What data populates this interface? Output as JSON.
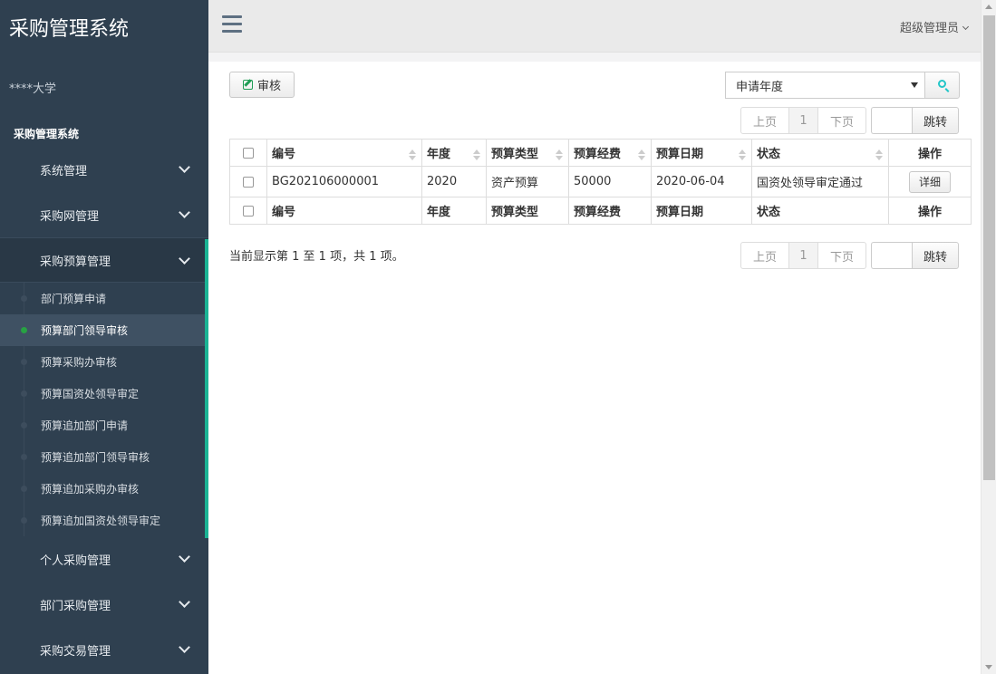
{
  "app": {
    "brand": "采购管理系统",
    "org": "****大学",
    "section_label": "采购管理系统"
  },
  "sidebar": {
    "groups": [
      {
        "label": "系统管理"
      },
      {
        "label": "采购网管理"
      },
      {
        "label": "采购预算管理"
      },
      {
        "label": "个人采购管理"
      },
      {
        "label": "部门采购管理"
      },
      {
        "label": "采购交易管理"
      }
    ],
    "submenu": [
      {
        "label": "部门预算申请"
      },
      {
        "label": "预算部门领导审核"
      },
      {
        "label": "预算采购办审核"
      },
      {
        "label": "预算国资处领导审定"
      },
      {
        "label": "预算追加部门申请"
      },
      {
        "label": "预算追加部门领导审核"
      },
      {
        "label": "预算追加采购办审核"
      },
      {
        "label": "预算追加国资处领导审定"
      }
    ]
  },
  "header": {
    "user": "超级管理员"
  },
  "toolbar": {
    "audit_label": "审核",
    "year_select": "申请年度"
  },
  "pager": {
    "prev": "上页",
    "page": "1",
    "next": "下页",
    "jump": "跳转"
  },
  "table": {
    "columns": [
      "编号",
      "年度",
      "预算类型",
      "预算经费",
      "预算日期",
      "状态",
      "操作"
    ],
    "rows": [
      {
        "id": "BG202106000001",
        "year": "2020",
        "type": "资产预算",
        "amount": "50000",
        "date": "2020-06-04",
        "status": "国资处领导审定通过",
        "action": "详细"
      }
    ]
  },
  "summary": "当前显示第 1 至 1 项，共 1 项。",
  "colors": {
    "sidebar_bg": "#2f4050",
    "accent": "#1ab394",
    "active_dot": "#27a243"
  }
}
